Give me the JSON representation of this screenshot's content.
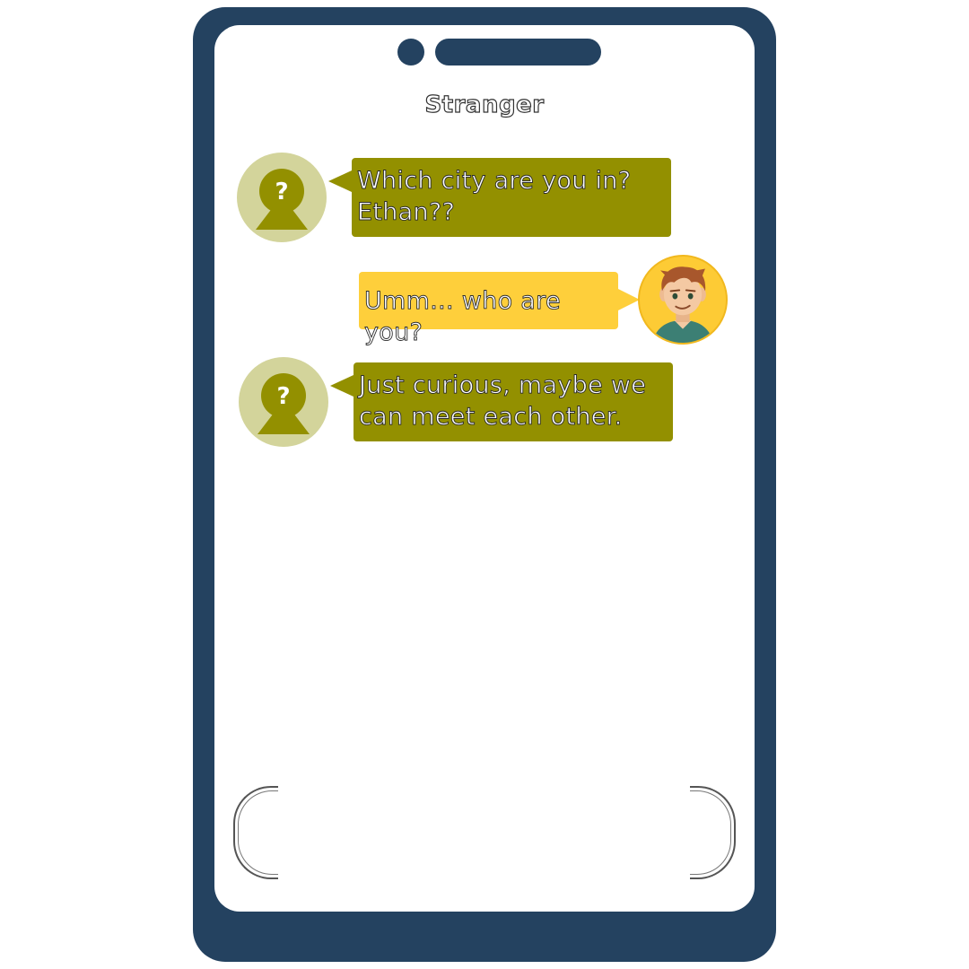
{
  "chat": {
    "contact_name": "Stranger",
    "messages": [
      {
        "sender": "stranger",
        "lines": [
          "Which city are you in?",
          "Ethan??"
        ]
      },
      {
        "sender": "me",
        "lines": [
          "Umm... who are you?"
        ]
      },
      {
        "sender": "stranger",
        "lines": [
          "Just curious, maybe we",
          "can meet each other."
        ]
      }
    ]
  },
  "composer": {
    "value": "",
    "placeholder": ""
  },
  "colors": {
    "phone_frame": "#244260",
    "incoming_bubble": "#939000",
    "outgoing_bubble": "#fecf3b",
    "stranger_avatar_bg": "#d3d49b",
    "user_avatar_bg": "#fdcb35"
  },
  "icons": {
    "stranger_avatar": "unknown-person-icon",
    "user_avatar": "user-avatar-boy"
  }
}
